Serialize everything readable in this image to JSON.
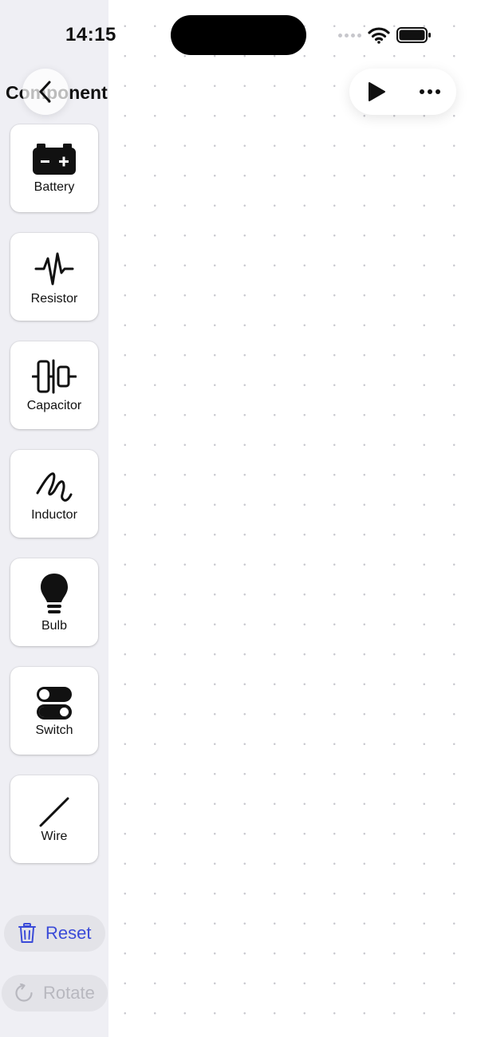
{
  "status_bar": {
    "time": "14:15",
    "signal_icon": "signal-dots-icon",
    "wifi_icon": "wifi-icon",
    "battery_icon": "battery-icon"
  },
  "nav": {
    "title": "Components",
    "back_icon": "chevron-left-icon"
  },
  "toolbar": {
    "play_icon": "play-icon",
    "more_icon": "ellipsis-icon"
  },
  "components": [
    {
      "label": "Battery",
      "icon": "battery-icon"
    },
    {
      "label": "Resistor",
      "icon": "resistor-icon"
    },
    {
      "label": "Capacitor",
      "icon": "capacitor-icon"
    },
    {
      "label": "Inductor",
      "icon": "inductor-icon"
    },
    {
      "label": "Bulb",
      "icon": "lightbulb-icon"
    },
    {
      "label": "Switch",
      "icon": "switch-icon"
    },
    {
      "label": "Wire",
      "icon": "wire-icon"
    }
  ],
  "actions": {
    "reset_label": "Reset",
    "reset_icon": "trash-icon",
    "rotate_label": "Rotate",
    "rotate_icon": "rotate-icon"
  },
  "colors": {
    "accent": "#3b4bd8",
    "disabled": "#b8b8bf",
    "sidebar_bg": "#efeff4",
    "canvas_dot": "#c9c9cf"
  }
}
